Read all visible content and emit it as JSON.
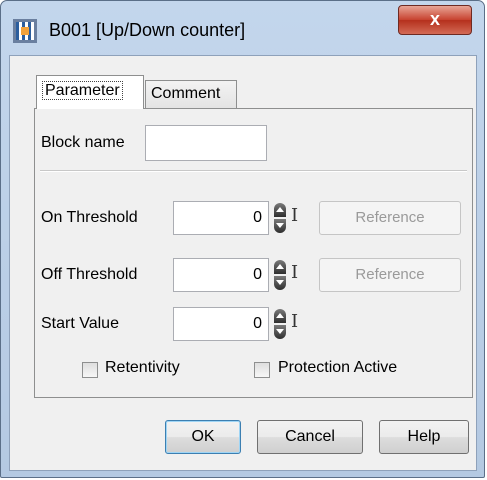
{
  "window": {
    "title": "B001 [Up/Down counter]",
    "close_label": "x"
  },
  "tabs": [
    {
      "label": "Parameter"
    },
    {
      "label": "Comment"
    }
  ],
  "block": {
    "name_label": "Block name",
    "name_value": ""
  },
  "on_threshold": {
    "label": "On Threshold",
    "value": "0",
    "reference_label": "Reference"
  },
  "off_threshold": {
    "label": "Off Threshold",
    "value": "0",
    "reference_label": "Reference"
  },
  "start_value": {
    "label": "Start Value",
    "value": "0"
  },
  "options": {
    "retentivity_label": "Retentivity",
    "protection_label": "Protection Active"
  },
  "buttons": {
    "ok": "OK",
    "cancel": "Cancel",
    "help": "Help"
  }
}
